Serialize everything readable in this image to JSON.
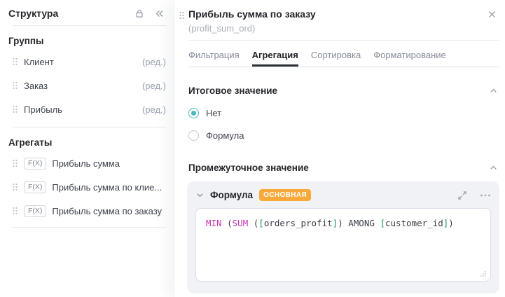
{
  "left_panel": {
    "title": "Структура",
    "groups_heading": "Группы",
    "groups": [
      {
        "label": "Клиент",
        "action": "(ред.)"
      },
      {
        "label": "Заказ",
        "action": "(ред.)"
      },
      {
        "label": "Прибыль",
        "action": "(ред.)"
      }
    ],
    "aggregates_heading": "Агрегаты",
    "aggregate_badge": "F(X)",
    "aggregates": [
      {
        "label": "Прибыль сумма"
      },
      {
        "label": "Прибыль сумма по клие..."
      },
      {
        "label": "Прибыль сумма по заказу"
      }
    ]
  },
  "panel": {
    "title": "Прибыль сумма по заказу",
    "subtitle": "(profit_sum_ord)",
    "tabs": [
      {
        "label": "Фильтрация",
        "active": false
      },
      {
        "label": "Агрегация",
        "active": true
      },
      {
        "label": "Сортировка",
        "active": false
      },
      {
        "label": "Форматирование",
        "active": false
      }
    ],
    "total_section": {
      "heading": "Итоговое значение",
      "options": [
        {
          "label": "Нет",
          "selected": true
        },
        {
          "label": "Формула",
          "selected": false
        }
      ]
    },
    "intermediate_section": {
      "heading": "Промежуточное значение",
      "card": {
        "title": "Формула",
        "badge": "ОСНОВНАЯ",
        "formula_text": "MIN (SUM ([orders_profit]) AMONG [customer_id])",
        "formula_tokens": [
          {
            "text": "MIN",
            "color": "keyword"
          },
          {
            "text": " (",
            "color": "plain"
          },
          {
            "text": "SUM",
            "color": "keyword"
          },
          {
            "text": " (",
            "color": "plain"
          },
          {
            "text": "[",
            "color": "bracket"
          },
          {
            "text": "orders_profit",
            "color": "plain"
          },
          {
            "text": "]",
            "color": "bracket"
          },
          {
            "text": ") ",
            "color": "plain"
          },
          {
            "text": "AMONG",
            "color": "plain"
          },
          {
            "text": " ",
            "color": "plain"
          },
          {
            "text": "[",
            "color": "bracket"
          },
          {
            "text": "customer_id",
            "color": "plain"
          },
          {
            "text": "]",
            "color": "bracket"
          },
          {
            "text": ")",
            "color": "plain"
          }
        ]
      }
    }
  },
  "colors": {
    "accent_teal": "#4bb8bf",
    "badge_orange": "#f8a93a",
    "keyword_magenta": "#c837b4",
    "bracket_green": "#169a58"
  }
}
